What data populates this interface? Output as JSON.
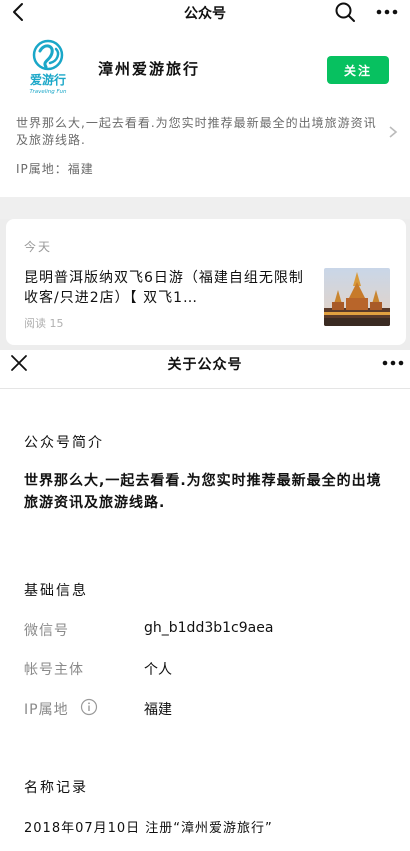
{
  "topbar": {
    "title": "公众号",
    "icons": {
      "back": "chevron-left-icon",
      "search": "search-icon",
      "more": "more-dots-icon"
    }
  },
  "profile": {
    "logo_text": "爱游行",
    "logo_sub": "Traveling Fun",
    "name": "漳州爱游旅行",
    "follow_label": "关注",
    "intro": "世界那么大,一起去看看.为您实时推荐最新最全的出境旅游资讯及旅游线路.",
    "ip_line": "IP属地：福建"
  },
  "article": {
    "date": "今天",
    "title": "昆明普洱版纳双飞6日游（福建自组无限制收客/只进2店）【 双飞1…",
    "read_count": "阅读 15"
  },
  "about": {
    "title": "关于公众号",
    "intro_heading": "公众号简介",
    "intro_text": "世界那么大,一起去看看.为您实时推荐最新最全的出境旅游资讯及旅游线路.",
    "basic_heading": "基础信息",
    "rows": [
      {
        "label": "微信号",
        "value": "gh_b1dd3b1c9aea"
      },
      {
        "label": "帐号主体",
        "value": "个人"
      },
      {
        "label": "IP属地",
        "value": "福建"
      }
    ],
    "history_heading": "名称记录",
    "history_item": "2018年07月10日 注册“漳州爱游旅行”"
  },
  "colors": {
    "accent": "#07c160",
    "muted_text": "#6b6b6b",
    "gray_zone": "#ededed",
    "logo_teal": "#1aa7c8",
    "logo_title": "#e8305a"
  }
}
